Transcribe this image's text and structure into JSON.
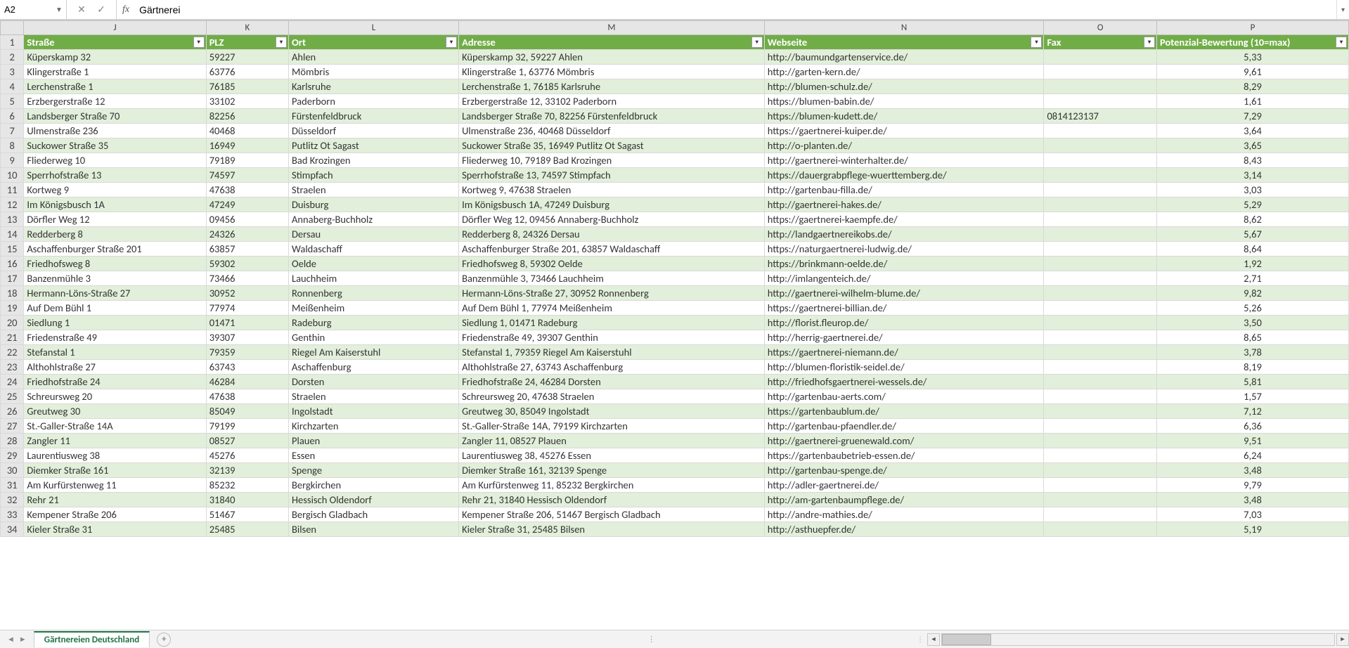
{
  "nameBox": "A2",
  "formulaValue": "Gärtnerei",
  "sheetTab": "Gärtnereien Deutschland",
  "columns": [
    {
      "letter": "J",
      "label": "Straße"
    },
    {
      "letter": "K",
      "label": "PLZ"
    },
    {
      "letter": "L",
      "label": "Ort"
    },
    {
      "letter": "M",
      "label": "Adresse"
    },
    {
      "letter": "N",
      "label": "Webseite"
    },
    {
      "letter": "O",
      "label": "Fax"
    },
    {
      "letter": "P",
      "label": "Potenzial-Bewertung (10=max)"
    }
  ],
  "rows": [
    {
      "n": 2,
      "J": "Küperskamp 32",
      "K": "59227",
      "L": "Ahlen",
      "M": "Küperskamp 32, 59227 Ahlen",
      "N": "http://baumundgartenservice.de/",
      "O": "",
      "P": "5,33"
    },
    {
      "n": 3,
      "J": "Klingerstraße 1",
      "K": "63776",
      "L": "Mömbris",
      "M": "Klingerstraße 1, 63776 Mömbris",
      "N": "http://garten-kern.de/",
      "O": "",
      "P": "9,61"
    },
    {
      "n": 4,
      "J": "Lerchenstraße 1",
      "K": "76185",
      "L": "Karlsruhe",
      "M": "Lerchenstraße 1, 76185 Karlsruhe",
      "N": "http://blumen-schulz.de/",
      "O": "",
      "P": "8,29"
    },
    {
      "n": 5,
      "J": "Erzbergerstraße 12",
      "K": "33102",
      "L": "Paderborn",
      "M": "Erzbergerstraße 12, 33102 Paderborn",
      "N": "https://blumen-babin.de/",
      "O": "",
      "P": "1,61"
    },
    {
      "n": 6,
      "J": "Landsberger Straße 70",
      "K": "82256",
      "L": "Fürstenfeldbruck",
      "M": "Landsberger Straße 70, 82256 Fürstenfeldbruck",
      "N": "https://blumen-kudett.de/",
      "O": "0814123137",
      "P": "7,29"
    },
    {
      "n": 7,
      "J": "Ulmenstraße 236",
      "K": "40468",
      "L": "Düsseldorf",
      "M": "Ulmenstraße 236, 40468 Düsseldorf",
      "N": "https://gaertnerei-kuiper.de/",
      "O": "",
      "P": "3,64"
    },
    {
      "n": 8,
      "J": "Suckower Straße 35",
      "K": "16949",
      "L": "Putlitz Ot Sagast",
      "M": "Suckower Straße 35, 16949 Putlitz Ot Sagast",
      "N": "http://o-planten.de/",
      "O": "",
      "P": "3,65"
    },
    {
      "n": 9,
      "J": "Fliederweg 10",
      "K": "79189",
      "L": "Bad Krozingen",
      "M": "Fliederweg 10, 79189 Bad Krozingen",
      "N": "http://gaertnerei-winterhalter.de/",
      "O": "",
      "P": "8,43"
    },
    {
      "n": 10,
      "J": "Sperrhofstraße 13",
      "K": "74597",
      "L": "Stimpfach",
      "M": "Sperrhofstraße 13, 74597 Stimpfach",
      "N": "https://dauergrabpflege-wuerttemberg.de/",
      "O": "",
      "P": "3,14"
    },
    {
      "n": 11,
      "J": "Kortweg 9",
      "K": "47638",
      "L": "Straelen",
      "M": "Kortweg 9, 47638 Straelen",
      "N": "http://gartenbau-filla.de/",
      "O": "",
      "P": "3,03"
    },
    {
      "n": 12,
      "J": "Im Königsbusch 1A",
      "K": "47249",
      "L": "Duisburg",
      "M": "Im Königsbusch 1A, 47249 Duisburg",
      "N": "http://gaertnerei-hakes.de/",
      "O": "",
      "P": "5,29"
    },
    {
      "n": 13,
      "J": "Dörfler Weg 12",
      "K": "09456",
      "L": "Annaberg-Buchholz",
      "M": "Dörfler Weg 12, 09456 Annaberg-Buchholz",
      "N": "https://gaertnerei-kaempfe.de/",
      "O": "",
      "P": "8,62"
    },
    {
      "n": 14,
      "J": "Redderberg 8",
      "K": "24326",
      "L": "Dersau",
      "M": "Redderberg 8, 24326 Dersau",
      "N": "http://landgaertnereikobs.de/",
      "O": "",
      "P": "5,67"
    },
    {
      "n": 15,
      "J": "Aschaffenburger Straße 201",
      "K": "63857",
      "L": "Waldaschaff",
      "M": "Aschaffenburger Straße 201, 63857 Waldaschaff",
      "N": "https://naturgaertnerei-ludwig.de/",
      "O": "",
      "P": "8,64"
    },
    {
      "n": 16,
      "J": "Friedhofsweg 8",
      "K": "59302",
      "L": "Oelde",
      "M": "Friedhofsweg 8, 59302 Oelde",
      "N": "https://brinkmann-oelde.de/",
      "O": "",
      "P": "1,92"
    },
    {
      "n": 17,
      "J": "Banzenmühle 3",
      "K": "73466",
      "L": "Lauchheim",
      "M": "Banzenmühle 3, 73466 Lauchheim",
      "N": "http://imlangenteich.de/",
      "O": "",
      "P": "2,71"
    },
    {
      "n": 18,
      "J": "Hermann-Löns-Straße 27",
      "K": "30952",
      "L": "Ronnenberg",
      "M": "Hermann-Löns-Straße 27, 30952 Ronnenberg",
      "N": "http://gaertnerei-wilhelm-blume.de/",
      "O": "",
      "P": "9,82"
    },
    {
      "n": 19,
      "J": "Auf Dem Bühl 1",
      "K": "77974",
      "L": "Meißenheim",
      "M": "Auf Dem Bühl 1, 77974 Meißenheim",
      "N": "https://gaertnerei-billian.de/",
      "O": "",
      "P": "5,26"
    },
    {
      "n": 20,
      "J": "Siedlung 1",
      "K": "01471",
      "L": "Radeburg",
      "M": "Siedlung 1, 01471 Radeburg",
      "N": "http://florist.fleurop.de/",
      "O": "",
      "P": "3,50"
    },
    {
      "n": 21,
      "J": "Friedenstraße 49",
      "K": "39307",
      "L": "Genthin",
      "M": "Friedenstraße 49, 39307 Genthin",
      "N": "http://herrig-gaertnerei.de/",
      "O": "",
      "P": "8,65"
    },
    {
      "n": 22,
      "J": "Stefanstal 1",
      "K": "79359",
      "L": "Riegel Am Kaiserstuhl",
      "M": "Stefanstal 1, 79359 Riegel Am Kaiserstuhl",
      "N": "https://gaertnerei-niemann.de/",
      "O": "",
      "P": "3,78"
    },
    {
      "n": 23,
      "J": "Althohlstraße 27",
      "K": "63743",
      "L": "Aschaffenburg",
      "M": "Althohlstraße 27, 63743 Aschaffenburg",
      "N": "http://blumen-floristik-seidel.de/",
      "O": "",
      "P": "8,19"
    },
    {
      "n": 24,
      "J": "Friedhofstraße 24",
      "K": "46284",
      "L": "Dorsten",
      "M": "Friedhofstraße 24, 46284 Dorsten",
      "N": "http://friedhofsgaertnerei-wessels.de/",
      "O": "",
      "P": "5,81"
    },
    {
      "n": 25,
      "J": "Schreursweg 20",
      "K": "47638",
      "L": "Straelen",
      "M": "Schreursweg 20, 47638 Straelen",
      "N": "http://gartenbau-aerts.com/",
      "O": "",
      "P": "1,57"
    },
    {
      "n": 26,
      "J": "Greutweg 30",
      "K": "85049",
      "L": "Ingolstadt",
      "M": "Greutweg 30, 85049 Ingolstadt",
      "N": "https://gartenbaublum.de/",
      "O": "",
      "P": "7,12"
    },
    {
      "n": 27,
      "J": "St.-Galler-Straße 14A",
      "K": "79199",
      "L": "Kirchzarten",
      "M": "St.-Galler-Straße 14A, 79199 Kirchzarten",
      "N": "http://gartenbau-pfaendler.de/",
      "O": "",
      "P": "6,36"
    },
    {
      "n": 28,
      "J": "Zangler 11",
      "K": "08527",
      "L": "Plauen",
      "M": "Zangler 11, 08527 Plauen",
      "N": "http://gaertnerei-gruenewald.com/",
      "O": "",
      "P": "9,51"
    },
    {
      "n": 29,
      "J": "Laurentiusweg 38",
      "K": "45276",
      "L": "Essen",
      "M": "Laurentiusweg 38, 45276 Essen",
      "N": "https://gartenbaubetrieb-essen.de/",
      "O": "",
      "P": "6,24"
    },
    {
      "n": 30,
      "J": "Diemker Straße 161",
      "K": "32139",
      "L": "Spenge",
      "M": "Diemker Straße 161, 32139 Spenge",
      "N": "http://gartenbau-spenge.de/",
      "O": "",
      "P": "3,48"
    },
    {
      "n": 31,
      "J": "Am Kurfürstenweg 11",
      "K": "85232",
      "L": "Bergkirchen",
      "M": "Am Kurfürstenweg 11, 85232 Bergkirchen",
      "N": "http://adler-gaertnerei.de/",
      "O": "",
      "P": "9,79"
    },
    {
      "n": 32,
      "J": "Rehr 21",
      "K": "31840",
      "L": "Hessisch Oldendorf",
      "M": "Rehr 21, 31840 Hessisch Oldendorf",
      "N": "http://am-gartenbaumpflege.de/",
      "O": "",
      "P": "3,48"
    },
    {
      "n": 33,
      "J": "Kempener Straße 206",
      "K": "51467",
      "L": "Bergisch Gladbach",
      "M": "Kempener Straße 206, 51467 Bergisch Gladbach",
      "N": "http://andre-mathies.de/",
      "O": "",
      "P": "7,03"
    },
    {
      "n": 34,
      "J": "Kieler Straße 31",
      "K": "25485",
      "L": "Bilsen",
      "M": "Kieler Straße 31, 25485 Bilsen",
      "N": "http://asthuepfer.de/",
      "O": "",
      "P": "5,19"
    }
  ]
}
